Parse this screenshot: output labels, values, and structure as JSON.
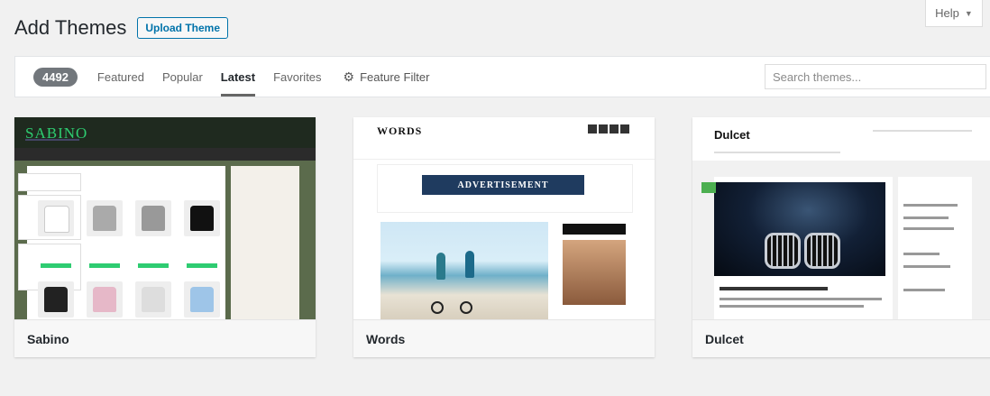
{
  "help": {
    "label": "Help"
  },
  "header": {
    "title": "Add Themes",
    "upload_label": "Upload Theme"
  },
  "filters": {
    "count": "4492",
    "links": [
      "Featured",
      "Popular",
      "Latest",
      "Favorites"
    ],
    "active": "Latest",
    "feature_filter_label": "Feature Filter"
  },
  "search": {
    "placeholder": "Search themes..."
  },
  "themes": [
    {
      "name": "Sabino",
      "logo_text": "SABINO",
      "accent": "#2ecc71"
    },
    {
      "name": "Words",
      "logo_text": "WORDS",
      "ad_text": "ADVERTISEMENT",
      "accent": "#1f3b5f"
    },
    {
      "name": "Dulcet",
      "logo_text": "Dulcet",
      "accent": "#4caf50"
    }
  ],
  "colors": {
    "primary_link": "#0073aa",
    "badge_bg": "#72777c",
    "page_bg": "#f1f1f1"
  }
}
